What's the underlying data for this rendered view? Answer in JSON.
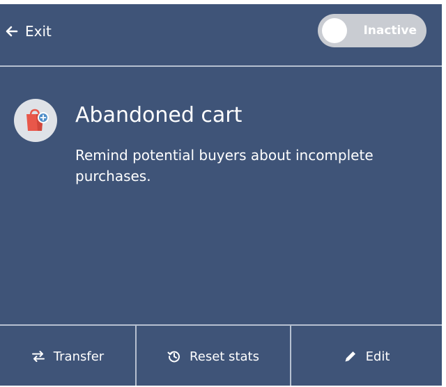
{
  "header": {
    "exit_label": "Exit",
    "exit_icon": "arrow-left-icon",
    "toggle": {
      "label": "Inactive",
      "state": "off"
    }
  },
  "feature": {
    "icon": "shopping-bag-plus-icon",
    "title": "Abandoned cart",
    "description": "Remind potential buyers about incomplete purchases."
  },
  "footer": {
    "buttons": [
      {
        "label": "Transfer",
        "icon": "swap-arrows-icon"
      },
      {
        "label": "Reset stats",
        "icon": "history-icon"
      },
      {
        "label": "Edit",
        "icon": "pencil-icon"
      }
    ]
  },
  "colors": {
    "panel_background": "#3f5478",
    "divider": "#b7c1d1",
    "toggle_track": "#c9ccd2",
    "bag": "#e8574a",
    "plus_badge": "#4f8ec9"
  }
}
